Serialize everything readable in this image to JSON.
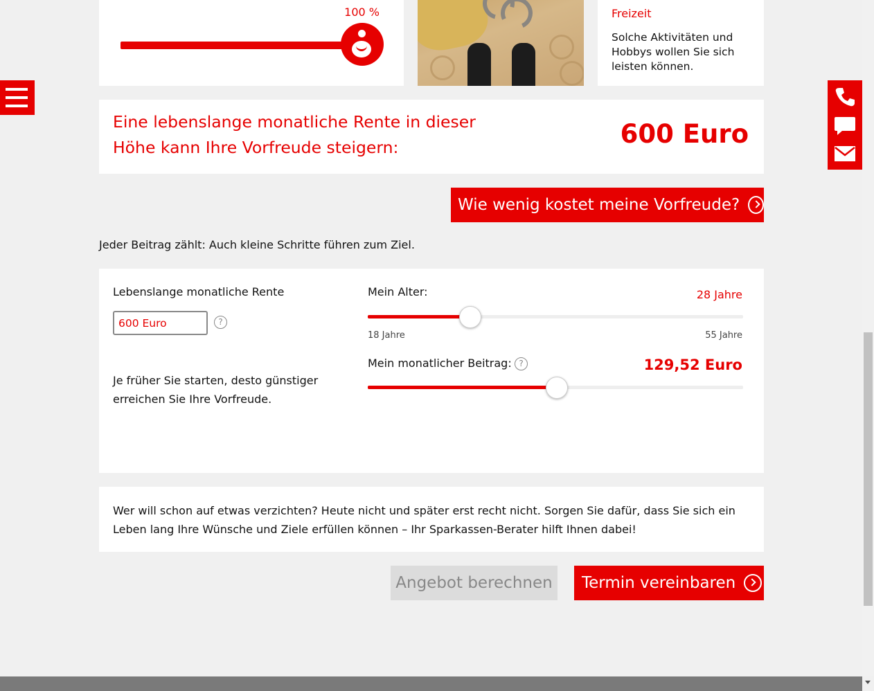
{
  "top": {
    "slider_percent_label": "100 %",
    "slider_level": 1.0,
    "category_title": "Freizeit",
    "category_text": "Solche Aktivitäten und Hobbys wollen Sie sich leisten können."
  },
  "rente_banner": {
    "text": "Eine lebenslange monatliche Rente in dieser Höhe kann Ihre Vorfreude steigern:",
    "amount": "600 Euro"
  },
  "buttons": {
    "cost_label": "Wie wenig kostet meine Vorfreude?",
    "angebot_label": "Angebot berechnen",
    "termin_label": "Termin vereinbaren"
  },
  "hint": "Jeder Beitrag zählt: Auch kleine Schritte führen zum Ziel.",
  "calculator": {
    "rente_label": "Lebenslange monatliche Rente",
    "rente_value": "600 Euro",
    "help_symbol": "?",
    "early_text": "Je früher Sie starten, desto günstiger erreichen Sie Ihre Vorfreude.",
    "age": {
      "label": "Mein Alter:",
      "value": "28 Jahre",
      "min_label": "18 Jahre",
      "max_label": "55 Jahre",
      "numeric": 28,
      "min": 18,
      "max": 55
    },
    "beitrag": {
      "label": "Mein monatlicher Beitrag:",
      "value": "129,52 Euro",
      "slider_level": 0.5
    }
  },
  "info_text": "Wer will schon auf etwas verzichten? Heute nicht und später erst recht nicht. Sorgen Sie dafür, dass Sie sich ein Leben lang Ihre Wünsche und Ziele erfüllen können – Ihr Sparkassen-Berater hilft Ihnen dabei!",
  "icons": {
    "menu": "hamburger-menu-icon",
    "contact": [
      "phone-icon",
      "chat-icon",
      "mail-icon"
    ]
  },
  "colors": {
    "accent": "#e60000",
    "background": "#f0f0f0",
    "disabled": "#dcdcdc"
  }
}
